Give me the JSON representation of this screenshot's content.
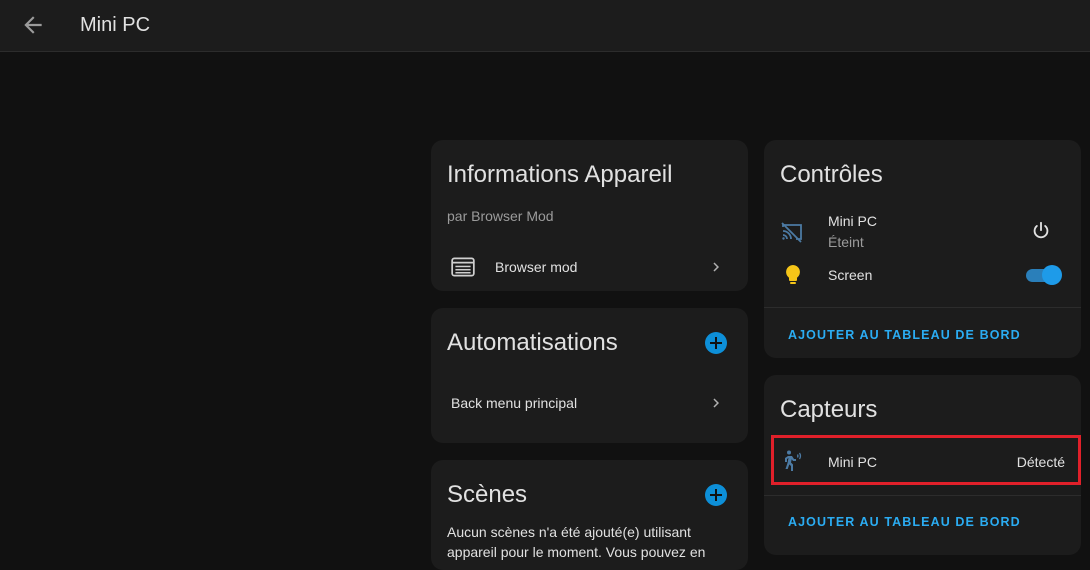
{
  "header": {
    "title": "Mini PC"
  },
  "device_info": {
    "title": "Informations Appareil",
    "by_line": "par Browser Mod",
    "integration_label": "Browser mod"
  },
  "automations": {
    "title": "Automatisations",
    "items": [
      {
        "label": "Back menu principal"
      }
    ]
  },
  "scenes": {
    "title": "Scènes",
    "empty_text_line1": "Aucun scènes n'a été ajouté(e) utilisant",
    "empty_text_line2": "appareil pour le moment. Vous pouvez en"
  },
  "controls": {
    "title": "Contrôles",
    "items": [
      {
        "name": "Mini PC",
        "state": "Éteint",
        "icon": "cast-off-icon",
        "action_icon": "power-icon"
      },
      {
        "name": "Screen",
        "icon": "lightbulb-icon",
        "toggle_on": true
      }
    ],
    "add_button": "AJOUTER AU TABLEAU DE BORD"
  },
  "sensors": {
    "title": "Capteurs",
    "items": [
      {
        "name": "Mini PC",
        "state": "Détecté",
        "icon": "motion-sensor-icon"
      }
    ],
    "add_button": "AJOUTER AU TABLEAU DE BORD"
  },
  "colors": {
    "accent": "#0d8fd8",
    "highlight": "#e0202a",
    "icon_blue": "#4c7aa3",
    "bulb": "#f5c518"
  }
}
